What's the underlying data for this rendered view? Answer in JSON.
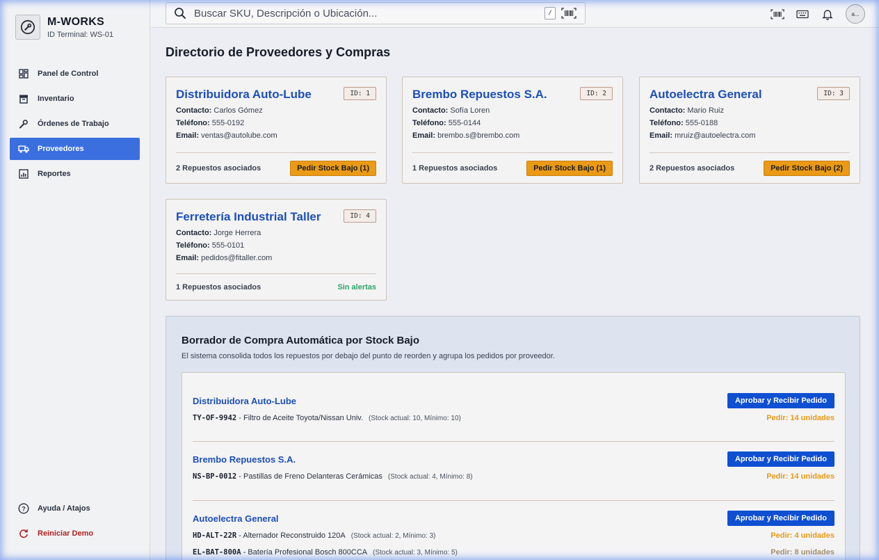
{
  "brand": {
    "name": "M-WORKS",
    "terminal": "ID Terminal: WS-01"
  },
  "nav": {
    "items": [
      {
        "label": "Panel de Control",
        "icon": "dashboard-icon",
        "active": false
      },
      {
        "label": "Inventario",
        "icon": "archive-icon",
        "active": false
      },
      {
        "label": "Órdenes de Trabajo",
        "icon": "wrench-icon",
        "active": false
      },
      {
        "label": "Proveedores",
        "icon": "truck-icon",
        "active": true
      },
      {
        "label": "Reportes",
        "icon": "bar-chart-icon",
        "active": false
      }
    ],
    "bottom": [
      {
        "label": "Ayuda / Atajos",
        "icon": "help-circle-icon"
      },
      {
        "label": "Reiniciar Demo",
        "icon": "refresh-icon"
      }
    ]
  },
  "topbar": {
    "search_placeholder": "Buscar SKU, Descripción o Ubicación...",
    "shortcut_key": "/",
    "avatar_text": "a..."
  },
  "page": {
    "title": "Directorio de Proveedores y Compras"
  },
  "suppliers": [
    {
      "name": "Distribuidora Auto-Lube",
      "id": "ID: 1",
      "contact_label": "Contacto:",
      "contact": "Carlos Gómez",
      "phone_label": "Teléfono:",
      "phone": "555-0192",
      "email_label": "Email:",
      "email": "ventas@autolube.com",
      "assoc": "2 Repuestos asociados",
      "action": "Pedir Stock Bajo (1)"
    },
    {
      "name": "Brembo Repuestos S.A.",
      "id": "ID: 2",
      "contact_label": "Contacto:",
      "contact": "Sofía Loren",
      "phone_label": "Teléfono:",
      "phone": "555-0144",
      "email_label": "Email:",
      "email": "brembo.s@brembo.com",
      "assoc": "1 Repuestos asociados",
      "action": "Pedir Stock Bajo (1)"
    },
    {
      "name": "Autoelectra General",
      "id": "ID: 3",
      "contact_label": "Contacto:",
      "contact": "Mario Ruiz",
      "phone_label": "Teléfono:",
      "phone": "555-0188",
      "email_label": "Email:",
      "email": "mruiz@autoelectra.com",
      "assoc": "2 Repuestos asociados",
      "action": "Pedir Stock Bajo (2)"
    },
    {
      "name": "Ferretería Industrial Taller",
      "id": "ID: 4",
      "contact_label": "Contacto:",
      "contact": "Jorge Herrera",
      "phone_label": "Teléfono:",
      "phone": "555-0101",
      "email_label": "Email:",
      "email": "pedidos@fitaller.com",
      "assoc": "1 Repuestos asociados",
      "status": "Sin alertas"
    }
  ],
  "draft": {
    "title": "Borrador de Compra Automática por Stock Bajo",
    "description": "El sistema consolida todos los repuestos por debajo del punto de reorden y agrupa los pedidos por proveedor.",
    "approve_label": "Aprobar y Recibir Pedido",
    "groups": [
      {
        "supplier": "Distribuidora Auto-Lube",
        "items": [
          {
            "sku": "TY-OF-9942",
            "desc": " - Filtro de Aceite Toyota/Nissan Univ.",
            "stock": "(Stock actual: 10, Mínimo: 10)",
            "order": "Pedir: 14 unidades"
          }
        ]
      },
      {
        "supplier": "Brembo Repuestos S.A.",
        "items": [
          {
            "sku": "NS-BP-0012",
            "desc": " - Pastillas de Freno Delanteras Cerámicas",
            "stock": "(Stock actual: 4, Mínimo: 8)",
            "order": "Pedir: 14 unidades"
          }
        ]
      },
      {
        "supplier": "Autoelectra General",
        "items": [
          {
            "sku": "HD-ALT-22R",
            "desc": " - Alternador Reconstruido 120A",
            "stock": "(Stock actual: 2, Mínimo: 3)",
            "order": "Pedir: 4 unidades"
          },
          {
            "sku": "EL-BAT-800A",
            "desc": " - Batería Profesional Bosch 800CCA",
            "stock": "(Stock actual: 3, Mínimo: 5)",
            "order": "Pedir: 8 unidades"
          }
        ]
      }
    ]
  }
}
